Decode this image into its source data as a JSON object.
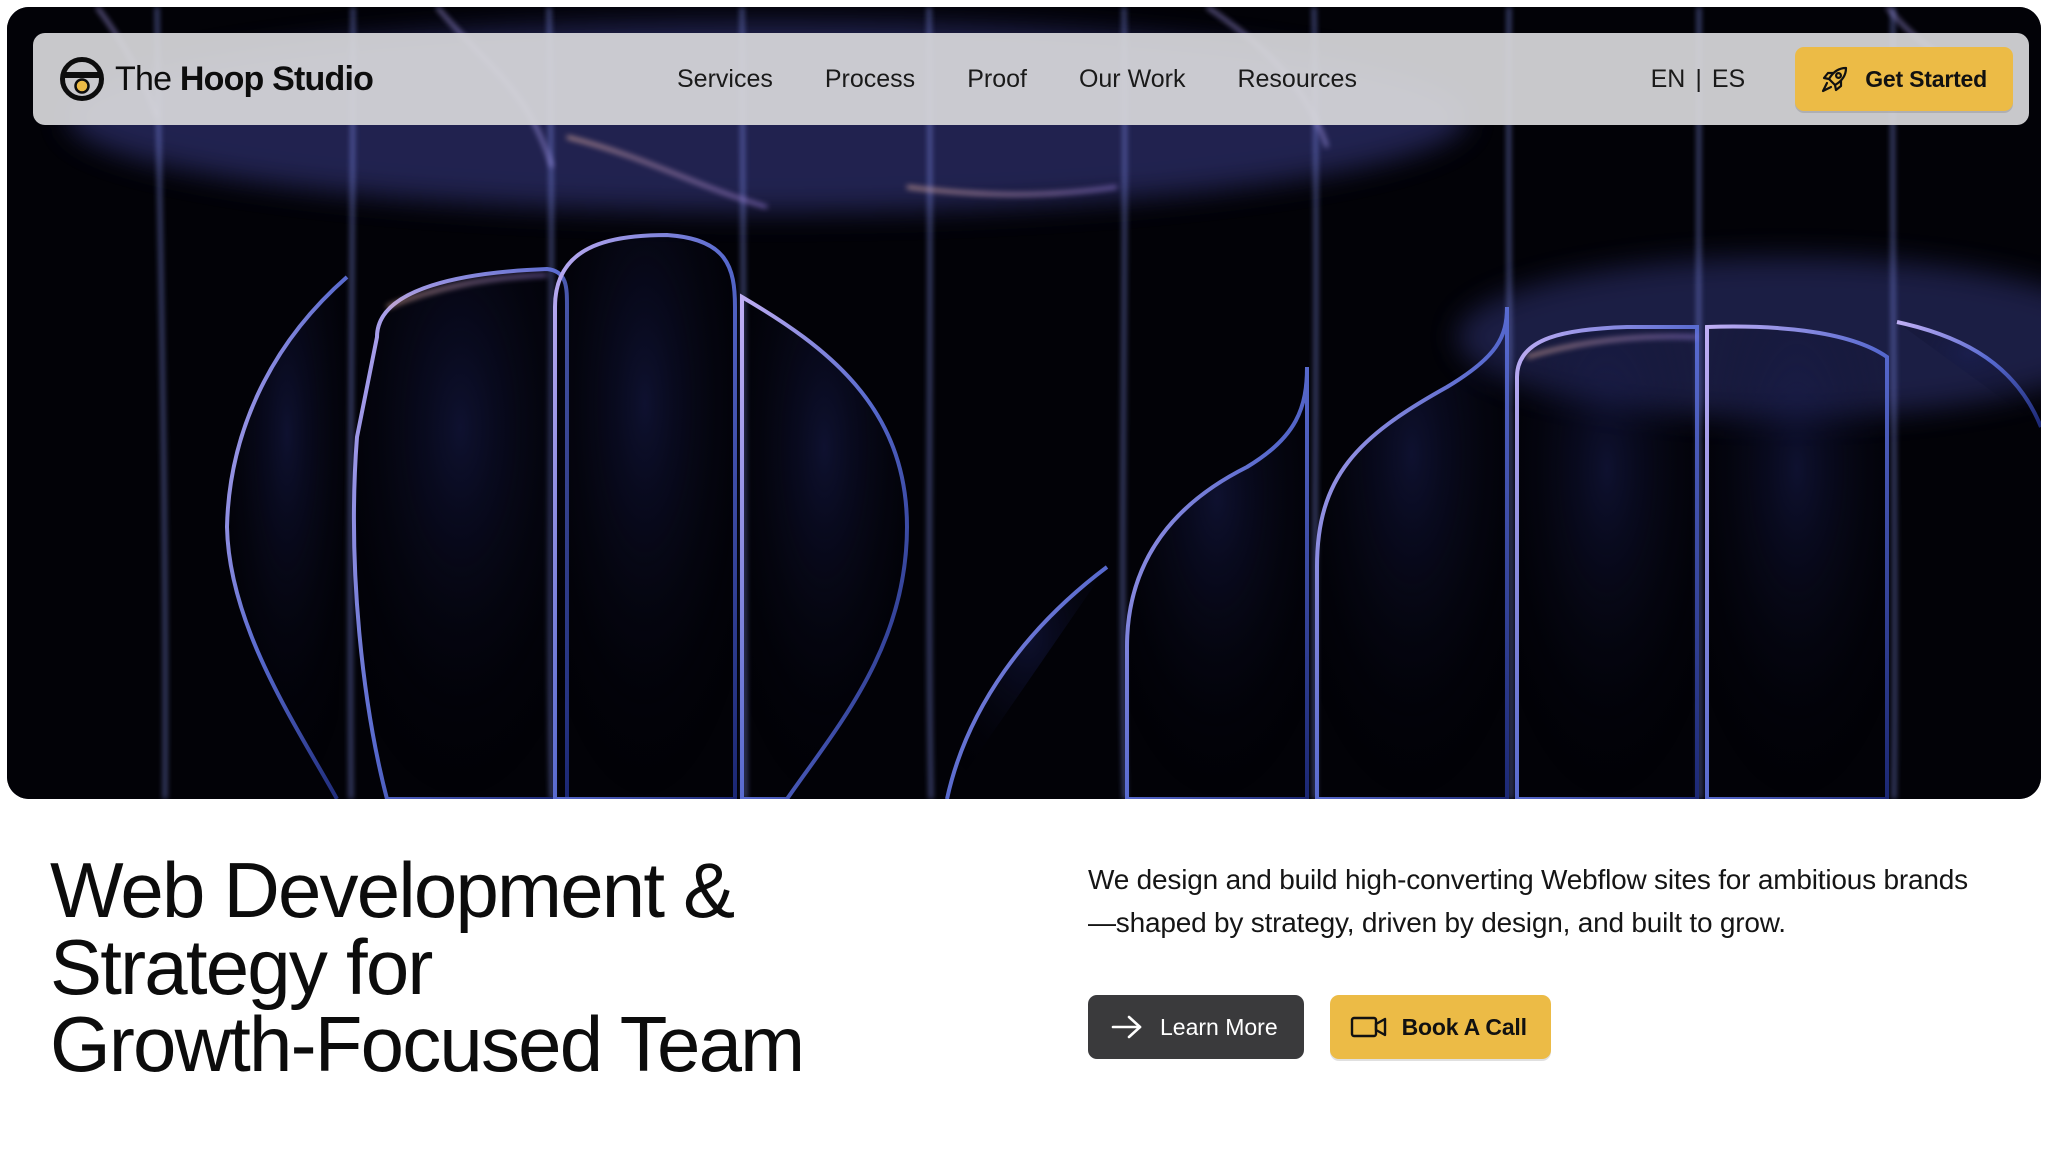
{
  "brand": {
    "name_light": "The",
    "name_bold": "Hoop Studio",
    "logo_icon": "hoop-logo-icon"
  },
  "nav": {
    "links": [
      {
        "label": "Services"
      },
      {
        "label": "Process"
      },
      {
        "label": "Proof"
      },
      {
        "label": "Our Work"
      },
      {
        "label": "Resources"
      }
    ],
    "lang": {
      "en": "EN",
      "separator": "|",
      "es": "ES"
    },
    "cta": {
      "label": "Get Started",
      "icon": "rocket-icon"
    }
  },
  "hero": {
    "headline_lines": [
      "Web Development &",
      "Strategy for",
      "Growth-Focused Team"
    ],
    "lead": "We design and build high-converting Webflow sites for ambitious brands—shaped by strategy, driven by design, and built to grow.",
    "primary_action": {
      "label": "Learn More",
      "icon": "arrow-right-icon"
    },
    "secondary_action": {
      "label": "Book A Call",
      "icon": "video-camera-icon"
    }
  },
  "colors": {
    "accent": "#ECBB46",
    "dark_button": "#3A3A3C",
    "hero_background": "#020207"
  }
}
